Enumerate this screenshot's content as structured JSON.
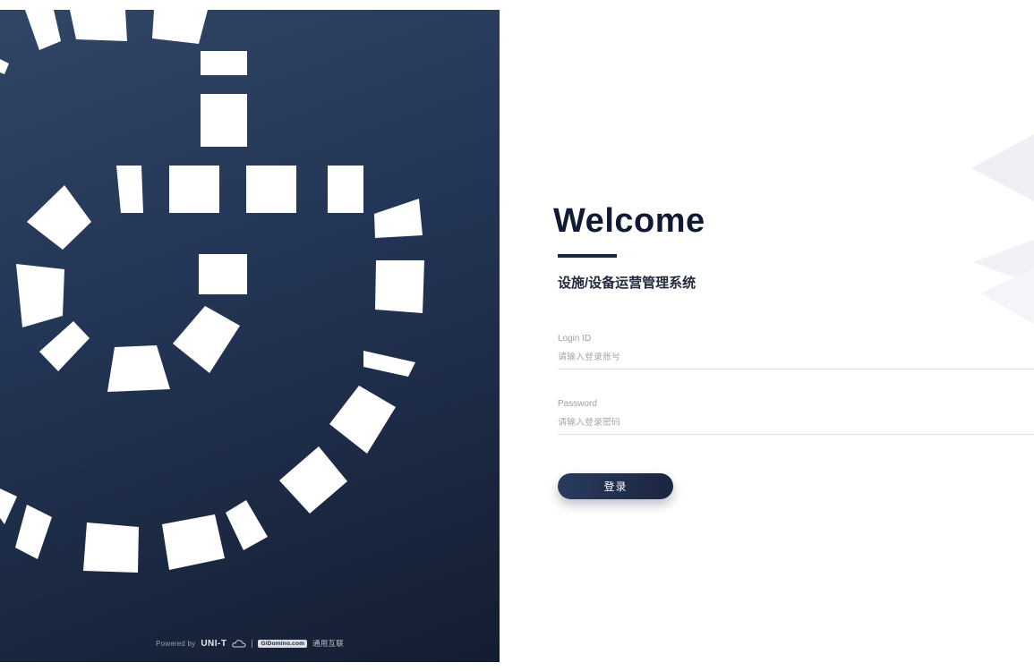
{
  "brand_panel": {
    "powered_by_label": "Powered by",
    "brand_name": "UNI-T",
    "domain_badge": "GiDomino.com",
    "partner_name": "通用互联",
    "colors": {
      "gradient_start": "#314566",
      "gradient_end": "#141d31",
      "art": "#ffffff"
    }
  },
  "login": {
    "title": "Welcome",
    "subtitle": "设施/设备运营管理系统",
    "login_id": {
      "label": "Login ID",
      "placeholder": "请输入登录账号",
      "value": ""
    },
    "password": {
      "label": "Password",
      "placeholder": "请输入登录密码",
      "value": ""
    },
    "submit_label": "登录",
    "colors": {
      "accent": "#1b2744"
    }
  }
}
